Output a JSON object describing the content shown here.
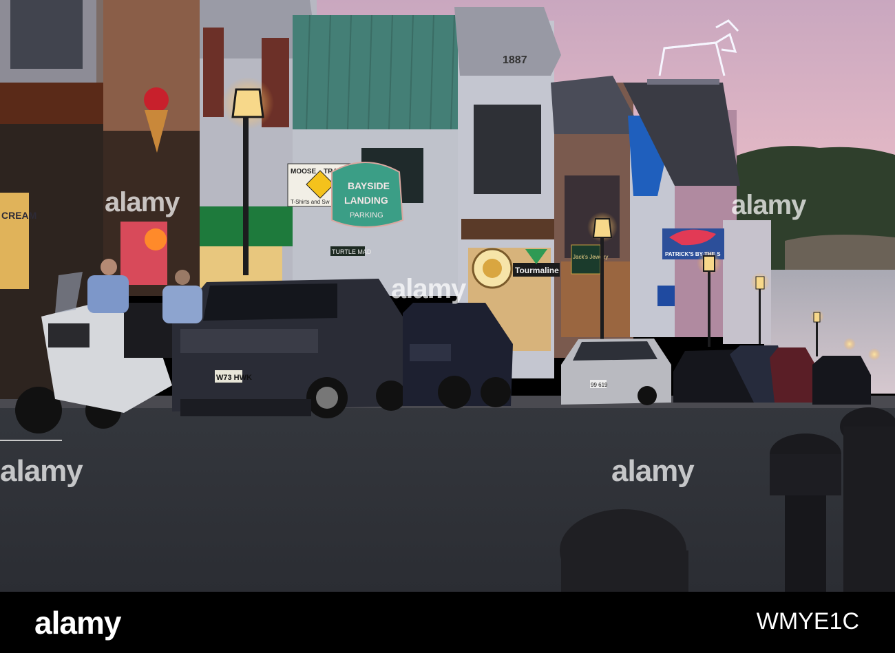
{
  "signs": {
    "moose_line1": "MOOSE",
    "moose_line2": "TRACKS",
    "moose_line3": "T-Shirts and Sw",
    "bayside_line1": "BAYSIDE",
    "bayside_line2": "LANDING",
    "bayside_line3": "PARKING",
    "tourmaline": "Tourmaline",
    "jacks": "Jack's Jewelry",
    "patricks": "PATRICK'S BY THE S",
    "year": "1887",
    "cream": "CREAM",
    "turtle": "TURTLE MAD"
  },
  "plates": {
    "suv": "W73 HWK",
    "silver_car": "99 619"
  },
  "watermarks": {
    "brand": "alamy"
  },
  "footer": {
    "logo": "alamy",
    "image_id": "WMYE1C"
  }
}
